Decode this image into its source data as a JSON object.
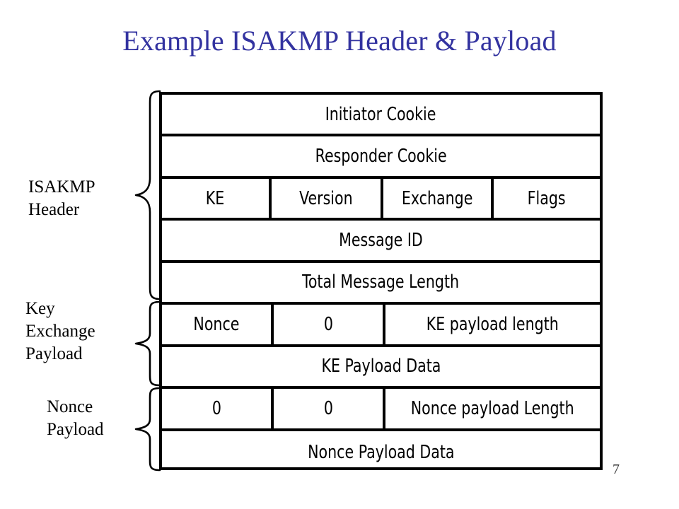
{
  "slide": {
    "title": "Example ISAKMP Header & Payload",
    "title_color": "#3333A0",
    "page_number": "7",
    "background_color": "#FFFFFF"
  },
  "diagram": {
    "type": "packet-format-diagram",
    "line_color": "#000000",
    "sections": [
      {
        "id": "isakmp-header",
        "label_lines": [
          "ISAKMP",
          "Header"
        ],
        "label": "ISAKMP Header",
        "row_span": [
          0,
          4
        ]
      },
      {
        "id": "key-exchange-payload",
        "label_lines": [
          "Key",
          "Exchange",
          "Payload"
        ],
        "label": "Key Exchange Payload",
        "row_span": [
          5,
          6
        ]
      },
      {
        "id": "nonce-payload",
        "label_lines": [
          "Nonce",
          "Payload"
        ],
        "label": "Nonce Payload",
        "row_span": [
          7,
          8
        ]
      }
    ],
    "rows": [
      {
        "id": "row-initiator-cookie",
        "cells": [
          {
            "text": "Initiator Cookie"
          }
        ]
      },
      {
        "id": "row-responder-cookie",
        "cells": [
          {
            "text": "Responder Cookie"
          }
        ]
      },
      {
        "id": "row-ke-version-exchange-flags",
        "cells": [
          {
            "text": "KE"
          },
          {
            "text": "Version"
          },
          {
            "text": "Exchange"
          },
          {
            "text": "Flags"
          }
        ]
      },
      {
        "id": "row-message-id",
        "cells": [
          {
            "text": "Message ID"
          }
        ]
      },
      {
        "id": "row-total-message-length",
        "cells": [
          {
            "text": "Total Message Length"
          }
        ]
      },
      {
        "id": "row-nonce-zero-kelength",
        "cells": [
          {
            "text": "Nonce"
          },
          {
            "text": "0"
          },
          {
            "text": "KE payload length"
          }
        ]
      },
      {
        "id": "row-ke-payload-data",
        "cells": [
          {
            "text": "KE Payload Data"
          }
        ]
      },
      {
        "id": "row-zero-zero-noncelength",
        "cells": [
          {
            "text": "0"
          },
          {
            "text": "0"
          },
          {
            "text": "Nonce payload Length"
          }
        ]
      },
      {
        "id": "row-nonce-payload-data",
        "cells": [
          {
            "text": "Nonce Payload Data"
          }
        ]
      }
    ]
  }
}
